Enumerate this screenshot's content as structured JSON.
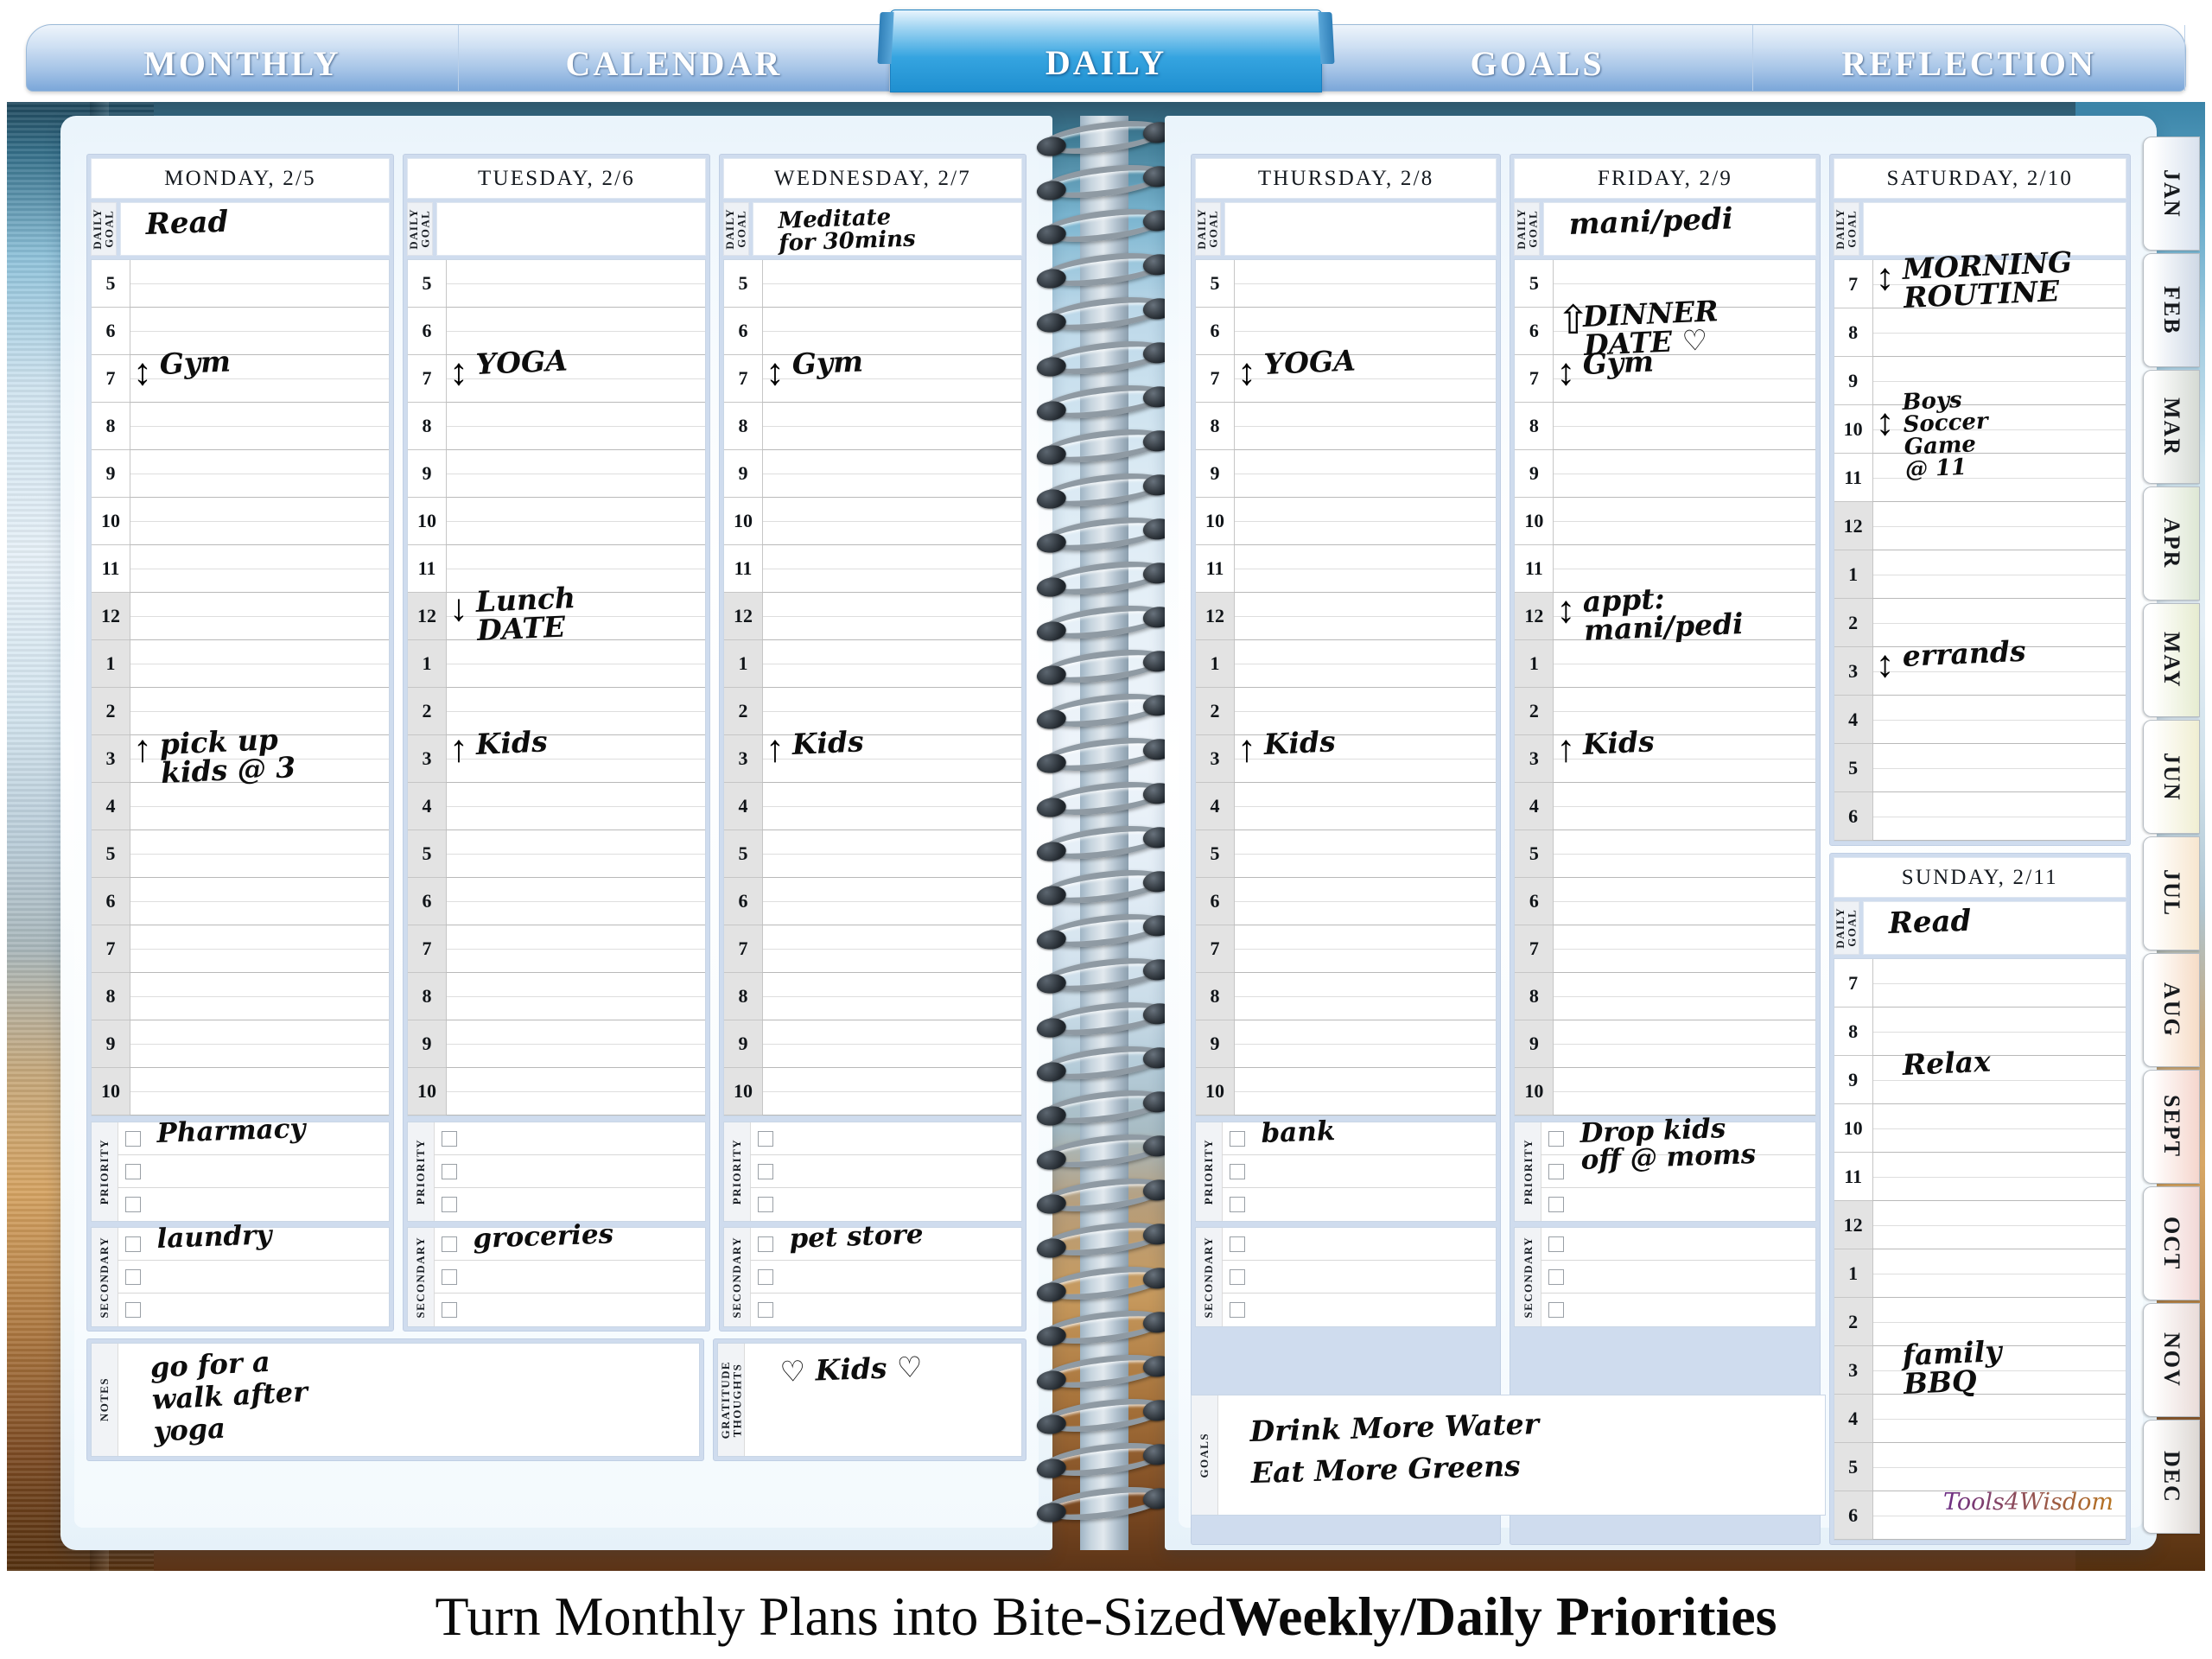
{
  "tabs": [
    {
      "label": "MONTHLY",
      "active": false
    },
    {
      "label": "CALENDAR",
      "active": false
    },
    {
      "label": "DAILY",
      "active": true
    },
    {
      "label": "GOALS",
      "active": false
    },
    {
      "label": "REFLECTION",
      "active": false
    }
  ],
  "caption": {
    "light": "Turn Monthly Plans into Bite-Sized ",
    "bold": "Weekly/Daily Priorities"
  },
  "labels": {
    "daily_goal": "DAILY\nGOAL",
    "priority": "PRIORITY",
    "secondary": "SECONDARY",
    "notes": "NOTES",
    "gratitude": "GRATITUDE\nTHOUGHTS",
    "goals": "GOALS"
  },
  "brand": "Tools4Wisdom",
  "weekday_hours": [
    "5",
    "6",
    "7",
    "8",
    "9",
    "10",
    "11",
    "12",
    "1",
    "2",
    "3",
    "4",
    "5",
    "6",
    "7",
    "8",
    "9",
    "10"
  ],
  "weekend_hours": [
    "7",
    "8",
    "9",
    "10",
    "11",
    "12",
    "1",
    "2",
    "3",
    "4",
    "5",
    "6"
  ],
  "pm_start_index_weekday": 7,
  "pm_start_index_weekend": 5,
  "left_page": {
    "days": [
      {
        "header": "MONDAY, 2/5",
        "daily_goal": "Read",
        "entries": [
          {
            "text": "Gym",
            "hour": "7",
            "arrow": "updown"
          },
          {
            "text": "pick up\nkids @ 3",
            "hour": "3",
            "arrow": "up"
          }
        ],
        "priority": [
          "Pharmacy",
          "",
          ""
        ],
        "secondary": [
          "laundry",
          "",
          ""
        ]
      },
      {
        "header": "TUESDAY, 2/6",
        "daily_goal": "",
        "entries": [
          {
            "text": "YOGA",
            "hour": "7",
            "arrow": "updown"
          },
          {
            "text": "Lunch\nDATE",
            "hour": "12",
            "arrow": "down"
          },
          {
            "text": "Kids",
            "hour": "3",
            "arrow": "up"
          }
        ],
        "priority": [
          "",
          "",
          ""
        ],
        "secondary": [
          "groceries",
          "",
          ""
        ]
      },
      {
        "header": "WEDNESDAY, 2/7",
        "daily_goal": "Meditate\nfor 30mins",
        "entries": [
          {
            "text": "Gym",
            "hour": "7",
            "arrow": "updown"
          },
          {
            "text": "Kids",
            "hour": "3",
            "arrow": "up"
          }
        ],
        "priority": [
          "",
          "",
          ""
        ],
        "secondary": [
          "pet store",
          "",
          ""
        ]
      }
    ],
    "notes": "go for a\nwalk after\nyoga",
    "gratitude": "♡ Kids ♡"
  },
  "right_page": {
    "days": [
      {
        "header": "THURSDAY, 2/8",
        "daily_goal": "",
        "entries": [
          {
            "text": "YOGA",
            "hour": "7",
            "arrow": "updown"
          },
          {
            "text": "Kids",
            "hour": "3",
            "arrow": "up"
          }
        ],
        "priority": [
          "bank",
          "",
          ""
        ],
        "secondary": [
          "",
          "",
          ""
        ]
      },
      {
        "header": "FRIDAY, 2/9",
        "daily_goal": "mani/pedi",
        "entries": [
          {
            "text": "Gym",
            "hour": "7",
            "arrow": "updown"
          },
          {
            "text": "appt:\nmani/pedi",
            "hour": "12",
            "arrow": "updown"
          },
          {
            "text": "Kids",
            "hour": "3",
            "arrow": "up"
          },
          {
            "text": "DINNER\nDATE ♡",
            "hour": "6",
            "arrow": "up-solid"
          }
        ],
        "priority": [
          "Drop kids\noff @ moms",
          "",
          ""
        ],
        "secondary": [
          "",
          "",
          ""
        ]
      }
    ],
    "saturday": {
      "header": "SATURDAY, 2/10",
      "daily_goal": "",
      "entries": [
        {
          "text": "MORNING\nROUTINE",
          "hour": "7",
          "arrow": "updown"
        },
        {
          "text": "Boys\nSoccer\nGame\n@ 11",
          "hour": "10",
          "arrow": "updown"
        },
        {
          "text": "errands",
          "hour": "3",
          "arrow": "updown"
        }
      ]
    },
    "sunday": {
      "header": "SUNDAY, 2/11",
      "daily_goal": "Read",
      "entries": [
        {
          "text": "Relax",
          "hour": "9"
        },
        {
          "text": "family\nBBQ",
          "hour": "3"
        }
      ]
    },
    "goals": "Drink More Water\nEat More Greens"
  },
  "month_tabs": [
    {
      "label": "JAN",
      "color": "#d9e2ee"
    },
    {
      "label": "FEB",
      "color": "#cfd9e6"
    },
    {
      "label": "MAR",
      "color": "#d5dad4"
    },
    {
      "label": "APR",
      "color": "#dee7d4"
    },
    {
      "label": "MAY",
      "color": "#e6ecd0"
    },
    {
      "label": "JUN",
      "color": "#f0eed2"
    },
    {
      "label": "JUL",
      "color": "#f7e6cf"
    },
    {
      "label": "AUG",
      "color": "#f6dcc6"
    },
    {
      "label": "SEPT",
      "color": "#f5d6cd"
    },
    {
      "label": "OCT",
      "color": "#f2d8d6"
    },
    {
      "label": "NOV",
      "color": "#eadcd9"
    },
    {
      "label": "DEC",
      "color": "#ddd8d4"
    }
  ]
}
